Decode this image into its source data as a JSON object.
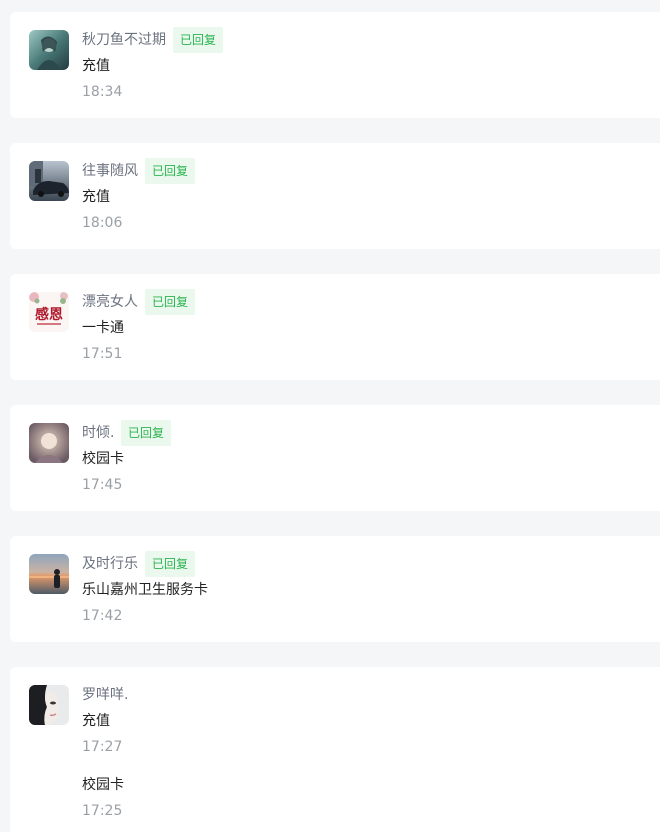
{
  "conversations": [
    {
      "name": "秋刀鱼不过期",
      "status": "已回复",
      "avatar_icon": "avatar-anime-figure",
      "messages": [
        {
          "text": "充值",
          "time": "18:34"
        }
      ]
    },
    {
      "name": "往事随风",
      "status": "已回复",
      "avatar_icon": "avatar-car",
      "messages": [
        {
          "text": "充值",
          "time": "18:06"
        }
      ]
    },
    {
      "name": "漂亮女人",
      "status": "已回复",
      "avatar_icon": "avatar-calligraphy",
      "avatar_text": "感恩",
      "messages": [
        {
          "text": "一卡通",
          "time": "17:51"
        }
      ]
    },
    {
      "name": "时倾.",
      "status": "已回复",
      "avatar_icon": "avatar-portrait",
      "messages": [
        {
          "text": "校园卡",
          "time": "17:45"
        }
      ]
    },
    {
      "name": "及时行乐",
      "status": "已回复",
      "avatar_icon": "avatar-sunset-beach",
      "messages": [
        {
          "text": "乐山嘉州卫生服务卡",
          "time": "17:42"
        }
      ]
    },
    {
      "name": "罗咩咩.",
      "status": "",
      "avatar_icon": "avatar-face-profile",
      "messages": [
        {
          "text": "充值",
          "time": "17:27"
        },
        {
          "text": "校园卡",
          "time": "17:25"
        }
      ]
    }
  ],
  "colors": {
    "background": "#f5f6f8",
    "card": "#ffffff",
    "name": "#6b7280",
    "badge_bg": "#eaf8ee",
    "badge_text": "#2bb34f",
    "time": "#9aa0a6"
  }
}
